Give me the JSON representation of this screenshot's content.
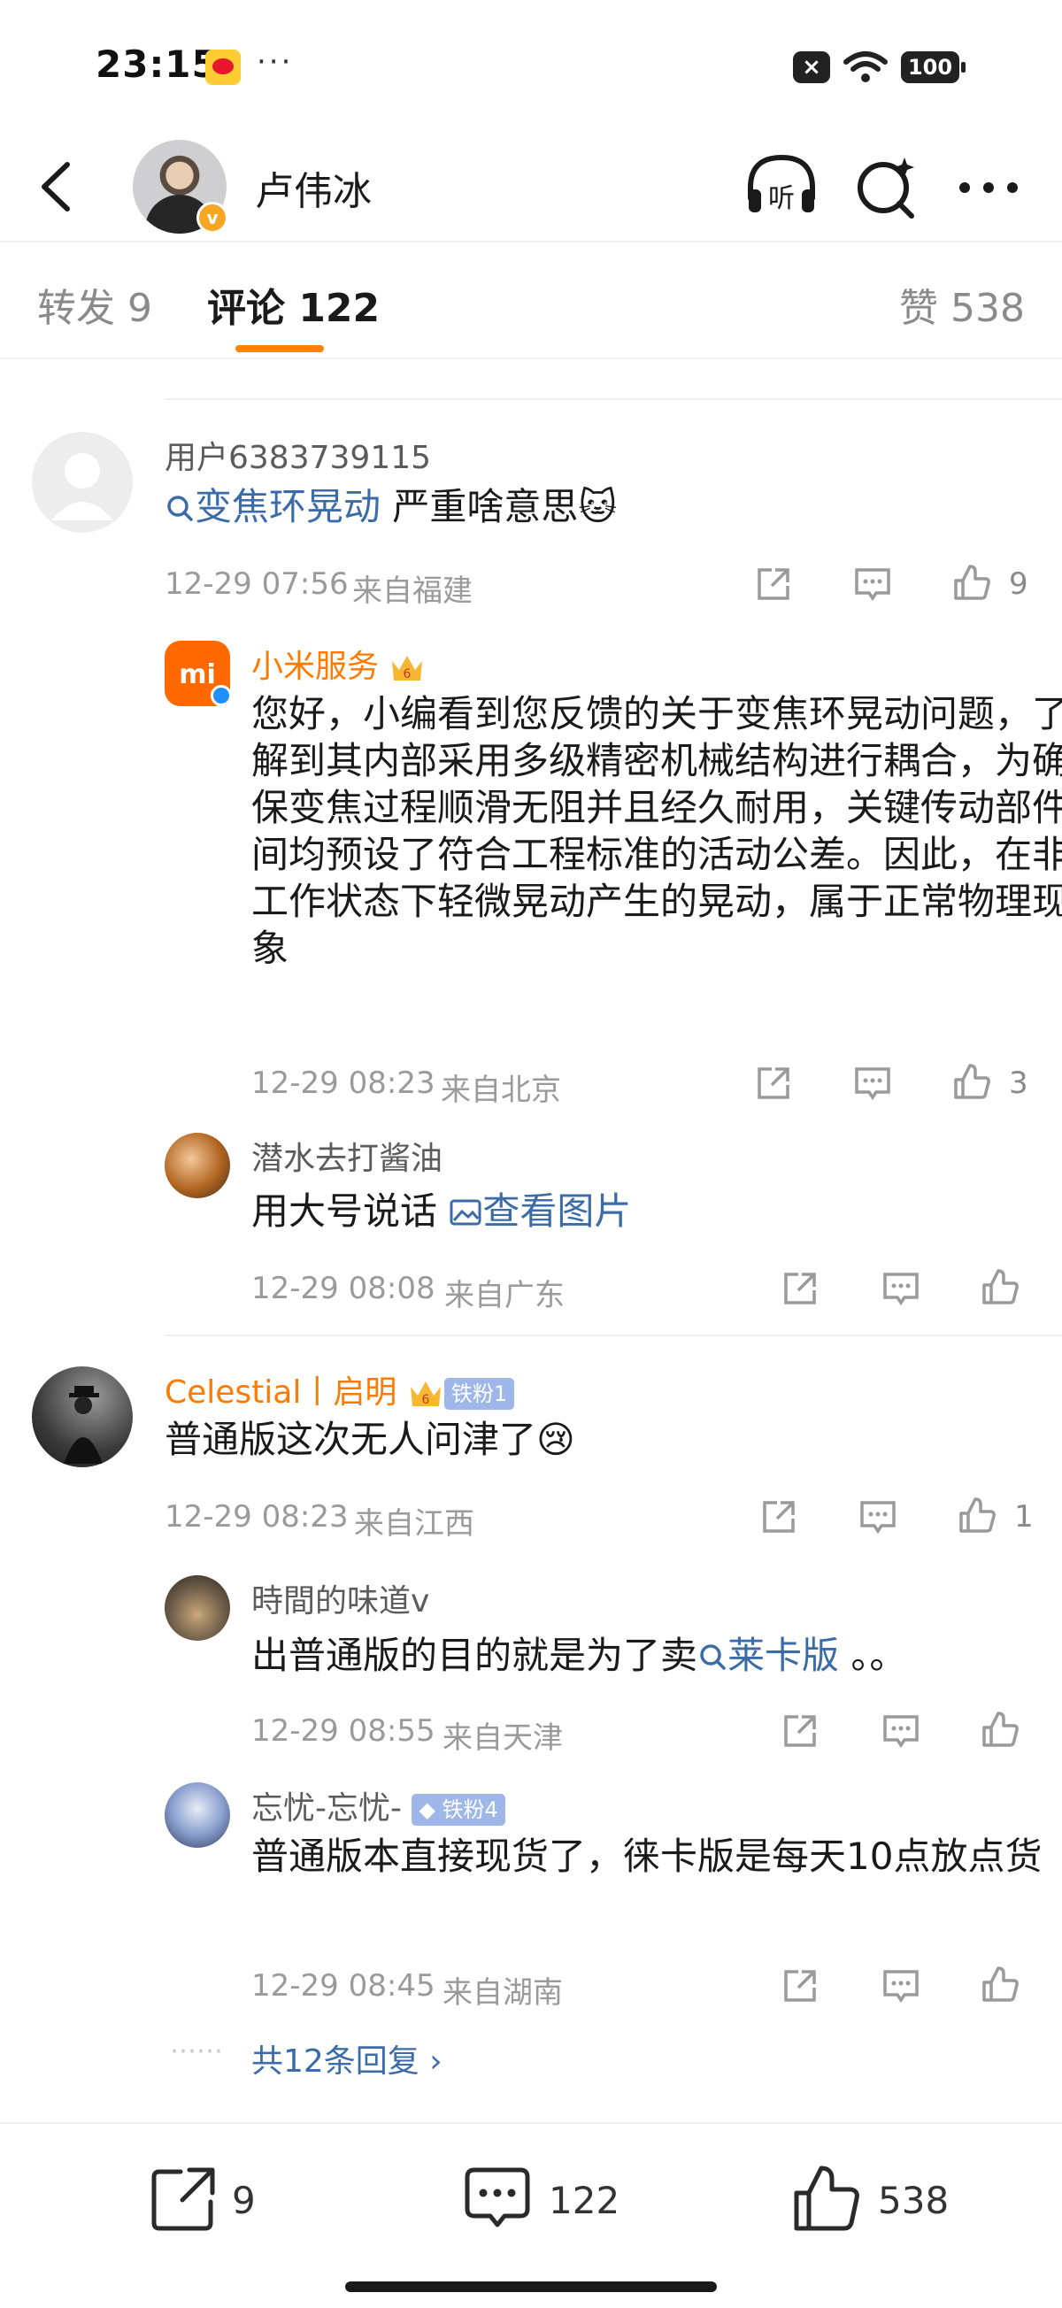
{
  "status_bar": {
    "time": "23:15",
    "dots": "···",
    "battery": "100"
  },
  "header": {
    "name": "卢伟冰",
    "verified": "v"
  },
  "tabs": {
    "repost": "转发 9",
    "comment": "评论 122",
    "like": "赞 538"
  },
  "comments": [
    {
      "user": "用户6383739115",
      "text_link": "变焦环晃动",
      "text_rest": " 严重啥意思🐱",
      "time": "12-29 07:56",
      "location": "来自福建",
      "likes": "9",
      "replies": [
        {
          "user": "小米服务",
          "text": "您好，小编看到您反馈的关于变焦环晃动问题，了解到其内部采用多级精密机械结构进行耦合，为确保变焦过程顺滑无阻并且经久耐用，关键传动部件间均预设了符合工程标准的活动公差。因此，在非工作状态下轻微晃动产生的晃动，属于正常物理现象",
          "time": "12-29 08:23",
          "location": "来自北京",
          "likes": "3"
        },
        {
          "user": "潜水去打酱油",
          "text": "用大号说话 ",
          "link": "查看图片",
          "time": "12-29 08:08",
          "location": "来自广东",
          "likes": ""
        }
      ]
    },
    {
      "user": "Celestial丨启明",
      "fan_badge": "铁粉1",
      "text": "普通版这次无人问津了😢",
      "time": "12-29 08:23",
      "location": "来自江西",
      "likes": "1",
      "replies": [
        {
          "user": "時間的味道v",
          "text": "出普通版的目的就是为了卖",
          "link": "莱卡版",
          "text_after": " 。。",
          "time": "12-29 08:55",
          "location": "来自天津"
        },
        {
          "user": "忘忧-忘忧-",
          "fan_badge": "铁粉4",
          "text": "普通版本直接现货了，徕卡版是每天10点放点货",
          "time": "12-29 08:45",
          "location": "来自湖南"
        }
      ],
      "more": "共12条回复 ›"
    }
  ],
  "bottom_bar": {
    "repost_count": "9",
    "comment_count": "122",
    "like_count": "538"
  },
  "colors": {
    "accent": "#ff8200",
    "link": "#3b6ca8",
    "vip_name": "#ff7a00"
  }
}
